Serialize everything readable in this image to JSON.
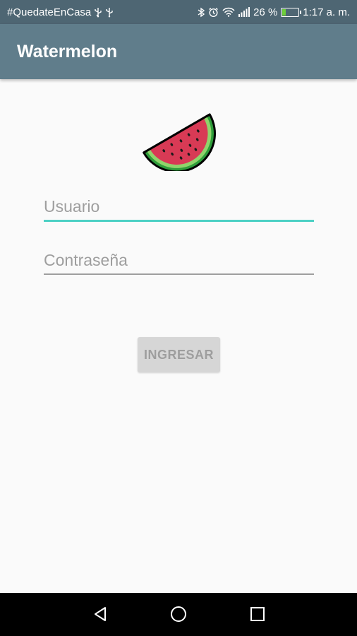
{
  "status_bar": {
    "left_text": "#QuedateEnCasa",
    "battery_percent": "26 %",
    "battery_level": 0.26,
    "time": "1:17 a. m.",
    "icons": [
      "usb-icon",
      "usb-icon",
      "bluetooth-icon",
      "alarm-icon",
      "wifi-icon",
      "signal-icon",
      "battery-icon"
    ]
  },
  "app_bar": {
    "title": "Watermelon",
    "color": "#607d8b"
  },
  "logo": {
    "icon": "watermelon-icon"
  },
  "form": {
    "username_placeholder": "Usuario",
    "password_placeholder": "Contraseña",
    "submit_label": "INGRESAR",
    "accent_color": "#4dd0c4"
  },
  "nav_bar": {
    "icons": [
      "back-icon",
      "home-icon",
      "recent-apps-icon"
    ]
  }
}
